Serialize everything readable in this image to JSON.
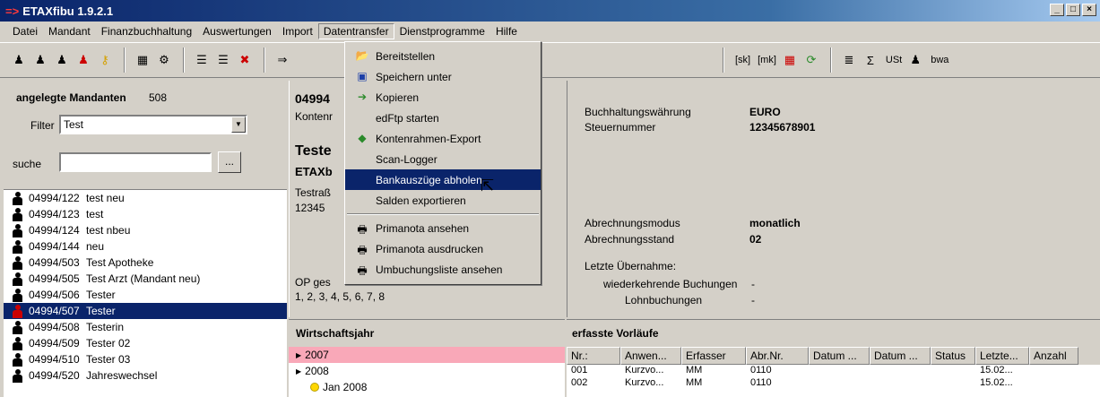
{
  "window": {
    "title": "ETAXfibu 1.9.2.1",
    "app_icon": "=>"
  },
  "menubar": [
    "Datei",
    "Mandant",
    "Finanzbuchhaltung",
    "Auswertungen",
    "Import",
    "Datentransfer",
    "Dienstprogramme",
    "Hilfe"
  ],
  "toolbar": {
    "sk": "[sk]",
    "mk": "[mk]",
    "ust": "USt",
    "bwa": "bwa"
  },
  "left": {
    "header": "angelegte Mandanten",
    "count": "508",
    "filter_label": "Filter",
    "filter_value": "Test",
    "search_label": "suche",
    "search_value": "",
    "dots": "...",
    "rows": [
      {
        "code": "04994/122",
        "name": "test neu"
      },
      {
        "code": "04994/123",
        "name": "test"
      },
      {
        "code": "04994/124",
        "name": "test nbeu"
      },
      {
        "code": "04994/144",
        "name": "neu"
      },
      {
        "code": "04994/503",
        "name": "Test Apotheke"
      },
      {
        "code": "04994/505",
        "name": "Test Arzt (Mandant neu)"
      },
      {
        "code": "04994/506",
        "name": "Tester"
      },
      {
        "code": "04994/507",
        "name": "Tester"
      },
      {
        "code": "04994/508",
        "name": "Testerin"
      },
      {
        "code": "04994/509",
        "name": "Tester 02"
      },
      {
        "code": "04994/510",
        "name": "Tester 03"
      },
      {
        "code": "04994/520",
        "name": "Jahreswechsel"
      }
    ]
  },
  "mid": {
    "code": "04994",
    "kontenr": "Kontenr",
    "name": "Teste",
    "etax": "ETAXb",
    "street": "Testraß",
    "zip": "12345",
    "op": "OP ges",
    "months": "1, 2, 3, 4, 5, 6, 7, 8"
  },
  "right": {
    "waehrung_label": "Buchhaltungswährung",
    "waehrung_value": "EURO",
    "steuer_label": "Steuernummer",
    "steuer_value": "12345678901",
    "modus_label": "Abrechnungsmodus",
    "modus_value": "monatlich",
    "stand_label": "Abrechnungsstand",
    "stand_value": "02",
    "letzte_label": "Letzte Übernahme:",
    "wied_label": "wiederkehrende Buchungen",
    "wied_value": "-",
    "lohn_label": "Lohnbuchungen",
    "lohn_value": "-"
  },
  "wj": {
    "header": "Wirtschaftsjahr",
    "rows": [
      "2007",
      "2008",
      "Jan 2008"
    ]
  },
  "ev": {
    "header": "erfasste Vorläufe",
    "columns": [
      "Nr.:",
      "Anwen...",
      "Erfasser",
      "Abr.Nr.",
      "Datum ...",
      "Datum ...",
      "Status",
      "Letzte...",
      "Anzahl"
    ],
    "rows": [
      [
        "001",
        "Kurzvo...",
        "MM",
        "0110",
        "",
        "",
        "",
        "15.02...",
        ""
      ],
      [
        "002",
        "Kurzvo...",
        "MM",
        "0110",
        "",
        "",
        "",
        "15.02...",
        ""
      ]
    ]
  },
  "dropdown": [
    "Bereitstellen",
    "Speichern unter",
    "Kopieren",
    "edFtp starten",
    "Kontenrahmen-Export",
    "Scan-Logger",
    "Bankauszüge abholen",
    "Salden exportieren",
    "Primanota ansehen",
    "Primanota ausdrucken",
    "Umbuchungsliste ansehen"
  ],
  "colors": {
    "title_bar": "#0a246a",
    "selection": "#0a246a",
    "year_highlight": "#f9a8b8",
    "face": "#d4d0c8"
  }
}
